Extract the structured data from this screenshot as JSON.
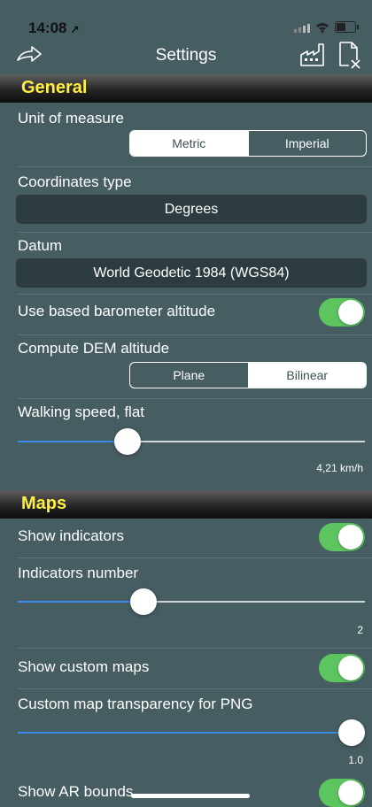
{
  "status_bar": {
    "time": "14:08",
    "location_arrow": "↗"
  },
  "nav": {
    "title": "Settings",
    "back_icon": "share-back-icon",
    "factory_icon": "factory-icon",
    "file_icon": "file-close-icon"
  },
  "general": {
    "header": "General",
    "unit_of_measure": {
      "label": "Unit of measure",
      "options": [
        "Metric",
        "Imperial"
      ],
      "selected": "Metric"
    },
    "coordinates_type": {
      "label": "Coordinates type",
      "value": "Degrees"
    },
    "datum": {
      "label": "Datum",
      "value": "World Geodetic 1984 (WGS84)"
    },
    "barometer": {
      "label": "Use based barometer altitude",
      "on": true
    },
    "dem_altitude": {
      "label": "Compute DEM altitude",
      "options": [
        "Plane",
        "Bilinear"
      ],
      "selected": "Bilinear"
    },
    "walking_speed": {
      "label": "Walking speed, flat",
      "value_text": "4,21 km/h",
      "position": 0.3
    }
  },
  "maps": {
    "header": "Maps",
    "show_indicators": {
      "label": "Show indicators",
      "on": true
    },
    "indicators_number": {
      "label": "Indicators number",
      "value_text": "2",
      "position": 0.35
    },
    "show_custom_maps": {
      "label": "Show custom maps",
      "on": true
    },
    "custom_map_transparency": {
      "label": "Custom map transparency for PNG",
      "value_text": "1.0",
      "position": 1.0
    },
    "show_ar_bounds": {
      "label": "Show AR bounds",
      "on": true
    }
  },
  "colors": {
    "background": "#465d62",
    "section_title": "#ffef3f",
    "toggle_on": "#5cc560",
    "slider_fill": "#3d8be6"
  }
}
